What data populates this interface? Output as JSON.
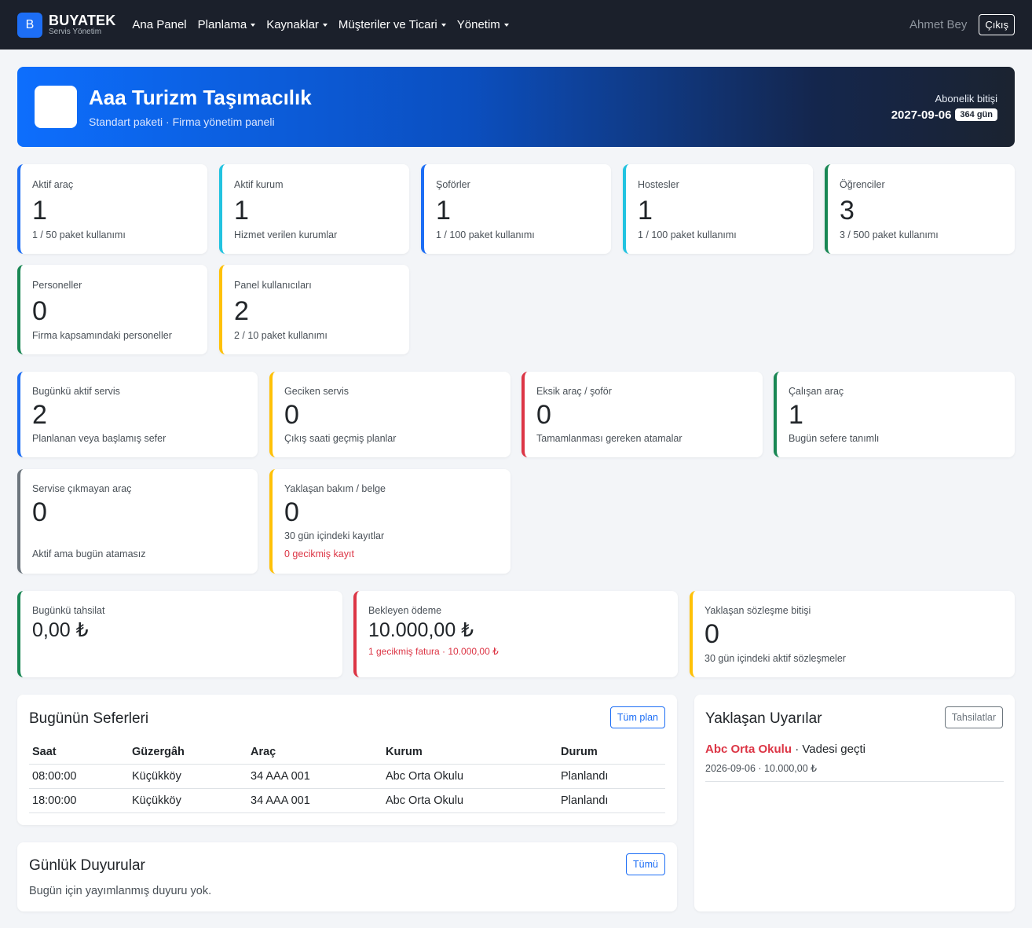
{
  "nav": {
    "brand_letter": "B",
    "brand_name": "BUYATEK",
    "brand_sub": "Servis Yönetim",
    "items": [
      "Ana Panel",
      "Planlama",
      "Kaynaklar",
      "Müşteriler ve Ticari",
      "Yönetim"
    ],
    "user": "Ahmet Bey",
    "logout": "Çıkış"
  },
  "hero": {
    "title": "Aaa Turizm Taşımacılık",
    "subtitle": "Standart paketi · Firma yönetim paneli",
    "sub_label": "Abonelik bitişi",
    "sub_date": "2027-09-06",
    "sub_days": "364 gün"
  },
  "stats": [
    {
      "label": "Aktif araç",
      "value": "1",
      "sub": "1 / 50 paket kullanımı"
    },
    {
      "label": "Aktif kurum",
      "value": "1",
      "sub": "Hizmet verilen kurumlar"
    },
    {
      "label": "Şoförler",
      "value": "1",
      "sub": "1 / 100 paket kullanımı"
    },
    {
      "label": "Hostesler",
      "value": "1",
      "sub": "1 / 100 paket kullanımı"
    },
    {
      "label": "Öğrenciler",
      "value": "3",
      "sub": "3 / 500 paket kullanımı"
    },
    {
      "label": "Personeller",
      "value": "0",
      "sub": "Firma kapsamındaki personeller"
    },
    {
      "label": "Panel kullanıcıları",
      "value": "2",
      "sub": "2 / 10 paket kullanımı"
    }
  ],
  "ops": [
    {
      "label": "Bugünkü aktif servis",
      "value": "2",
      "sub": "Planlanan veya başlamış sefer"
    },
    {
      "label": "Geciken servis",
      "value": "0",
      "sub": "Çıkış saati geçmiş planlar"
    },
    {
      "label": "Eksik araç / şoför",
      "value": "0",
      "sub": "Tamamlanması gereken atamalar"
    },
    {
      "label": "Çalışan araç",
      "value": "1",
      "sub": "Bugün sefere tanımlı"
    },
    {
      "label": "Servise çıkmayan araç",
      "value": "0",
      "sub": "Aktif ama bugün atamasız"
    },
    {
      "label": "Yaklaşan bakım / belge",
      "value": "0",
      "sub": "30 gün içindeki kayıtlar",
      "sub2": "0 gecikmiş kayıt"
    }
  ],
  "finance": [
    {
      "label": "Bugünkü tahsilat",
      "value": "0,00 ₺"
    },
    {
      "label": "Bekleyen ödeme",
      "value": "10.000,00 ₺",
      "sub": "1 gecikmiş fatura · 10.000,00 ₺"
    },
    {
      "label": "Yaklaşan sözleşme bitişi",
      "value": "0",
      "sub": "30 gün içindeki aktif sözleşmeler"
    }
  ],
  "trips": {
    "title": "Bugünün Seferleri",
    "button": "Tüm plan",
    "columns": [
      "Saat",
      "Güzergâh",
      "Araç",
      "Kurum",
      "Durum"
    ],
    "rows": [
      [
        "08:00:00",
        "Küçükköy",
        "34 AAA 001",
        "Abc Orta Okulu",
        "Planlandı"
      ],
      [
        "18:00:00",
        "Küçükköy",
        "34 AAA 001",
        "Abc Orta Okulu",
        "Planlandı"
      ]
    ]
  },
  "announcements": {
    "title": "Günlük Duyurular",
    "button": "Tümü",
    "empty": "Bugün için yayımlanmış duyuru yok."
  },
  "alerts": {
    "title": "Yaklaşan Uyarılar",
    "button": "Tahsilatlar",
    "items": [
      {
        "name": "Abc Orta Okulu",
        "status": " · Vadesi geçti",
        "detail": "2026-09-06 · 10.000,00 ₺"
      }
    ]
  },
  "colors": {
    "navbar": "#1b202b",
    "primary": "#1d6ef5",
    "danger": "#dc3545",
    "success": "#198754",
    "warning": "#ffc107",
    "info": "#22c3e0",
    "secondary": "#6c757d"
  }
}
